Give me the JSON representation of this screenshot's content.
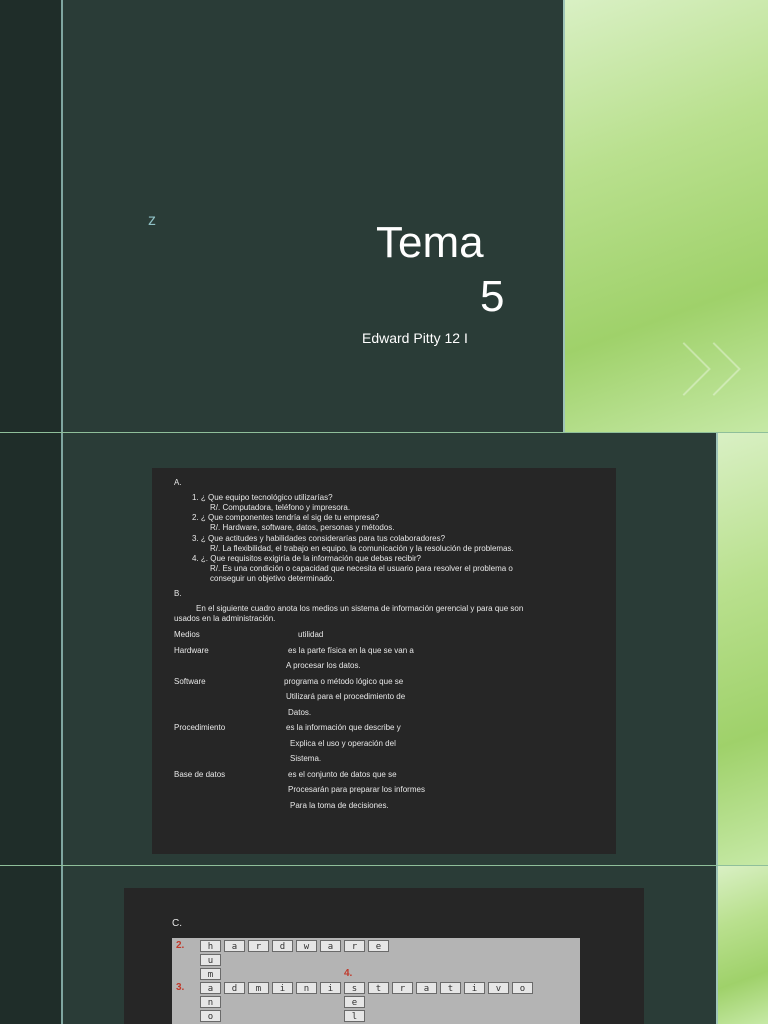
{
  "slide1": {
    "logo": "z",
    "title_line1": "Tema",
    "title_line2": "5",
    "author": "Edward Pitty 12 I"
  },
  "slide2": {
    "lines": [
      "A.",
      "1.   ¿ Que equipo tecnológico utilizarías?",
      "R/. Computadora, teléfono y impresora.",
      "2.   ¿ Que componentes tendría el sig de tu empresa?",
      "R/. Hardware, software, datos, personas y métodos.",
      "3.   ¿ Que actitudes y habilidades considerarías para tus colaboradores?",
      "R/. La flexibilidad, el trabajo en equipo, la comunicación y la resolución de problemas.",
      "4.   ¿.  Que requisitos exigiría de la información que debas recibir?",
      "R/. Es una condición o capacidad que necesita el usuario para resolver el problema o",
      "conseguir un objetivo determinado.",
      "B.",
      "En el siguiente cuadro anota los medios un sistema de información gerencial y para que son",
      "usados  en la administración.",
      "Medios",
      "utilidad",
      "Hardware",
      "es la parte física en la que se van a",
      "A procesar los datos.",
      "Software",
      "programa o método lógico que se",
      "Utilizará para el procedimiento de",
      "Datos.",
      "Procedimiento",
      "es la información que describe y",
      "Explica el uso y operación del",
      "Sistema.",
      "Base de datos",
      "es el conjunto de datos que se",
      "Procesarán para preparar los informes",
      "Para la toma de decisiones."
    ]
  },
  "slide3": {
    "label": "C.",
    "numbers": [
      "2.",
      "3.",
      "4."
    ],
    "row1": [
      "h",
      "a",
      "r",
      "d",
      "w",
      "a",
      "r",
      "e"
    ],
    "col1": [
      "u",
      "m",
      "n",
      "o"
    ],
    "row3": [
      "a",
      "d",
      "m",
      "i",
      "n",
      "i",
      "s",
      "t",
      "r",
      "a",
      "t",
      "i",
      "v",
      "o"
    ],
    "col4": [
      "e",
      "l"
    ]
  }
}
